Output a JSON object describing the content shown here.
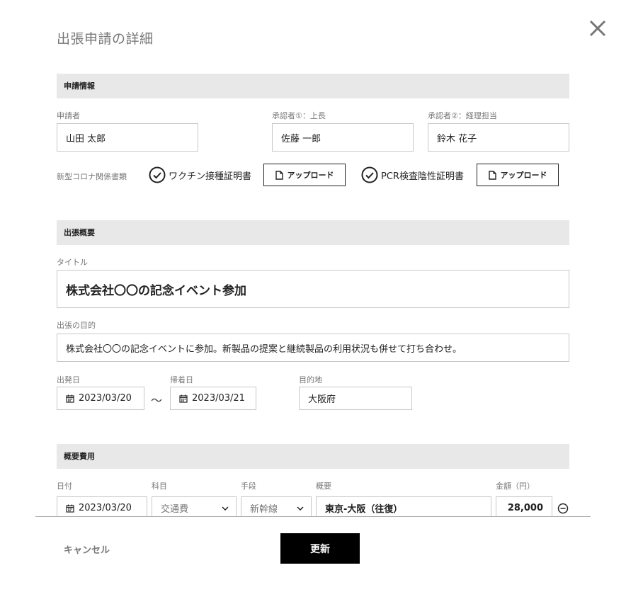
{
  "modal": {
    "title": "出張申請の詳細"
  },
  "sections": {
    "application_info": "申請情報",
    "trip_summary": "出張概要",
    "expenses": "概要費用"
  },
  "applicant": {
    "label": "申請者",
    "value": "山田 太郎"
  },
  "approver1": {
    "label": "承認者①：上長",
    "value": "佐藤 一郎"
  },
  "approver2": {
    "label": "承認者②：経理担当",
    "value": "鈴木 花子"
  },
  "covid_docs": {
    "label": "新型コロナ関係書類",
    "vaccine_label": "ワクチン接種証明書",
    "pcr_label": "PCR検査陰性証明書",
    "upload_label": "アップロード"
  },
  "trip": {
    "title_label": "タイトル",
    "title_value": "株式会社〇〇の記念イベント参加",
    "purpose_label": "出張の目的",
    "purpose_value": "株式会社〇〇の記念イベントに参加。新製品の提案と継続製品の利用状況も併せて打ち合わせ。",
    "depart_label": "出発日",
    "depart_value": "2023/03/20",
    "tilde": "〜",
    "return_label": "帰着日",
    "return_value": "2023/03/21",
    "destination_label": "目的地",
    "destination_value": "大阪府"
  },
  "expense_table": {
    "headers": {
      "date": "日付",
      "category": "科目",
      "means": "手段",
      "summary": "概要",
      "amount": "金額（円）"
    },
    "rows": [
      {
        "date": "2023/03/20",
        "category": "交通費",
        "means": "新幹線",
        "summary": "東京-大阪（往復）",
        "amount": "28,000"
      }
    ]
  },
  "footer": {
    "cancel": "キャンセル",
    "update": "更新"
  }
}
